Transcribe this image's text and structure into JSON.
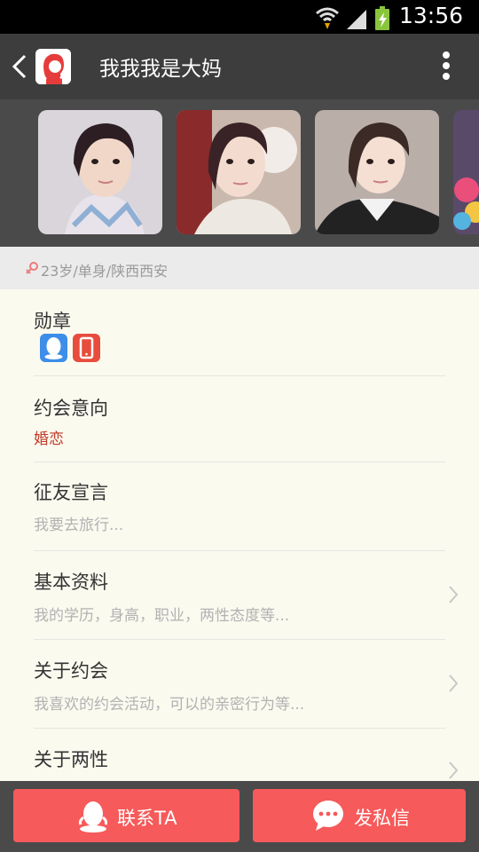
{
  "status_bar": {
    "time": "13:56"
  },
  "header": {
    "title": "我我我是大妈"
  },
  "profile_info": "23岁/单身/陕西西安",
  "sections": {
    "badges": {
      "title": "勋章"
    },
    "dating_intent": {
      "title": "约会意向",
      "value": "婚恋"
    },
    "manifesto": {
      "title": "征友宣言",
      "value": "我要去旅行..."
    },
    "basic_info": {
      "title": "基本资料",
      "value": "我的学历，身高，职业，两性态度等..."
    },
    "about_dating": {
      "title": "关于约会",
      "value": "我喜欢的约会活动，可以的亲密行为等..."
    },
    "about_gender": {
      "title": "关于两性"
    }
  },
  "bottom_bar": {
    "contact_label": "联系TA",
    "message_label": "发私信"
  },
  "colors": {
    "accent": "#f65a5a",
    "header_bg": "#3d3d3d",
    "badge_qq": "#3d8ee8",
    "badge_phone": "#e74c3c",
    "intent_red": "#c0392b"
  },
  "icons": [
    "wifi-icon",
    "signal-icon",
    "battery-icon",
    "back-arrow-icon",
    "more-vertical-icon",
    "female-icon",
    "qq-badge-icon",
    "phone-badge-icon",
    "chevron-right-icon",
    "penguin-icon",
    "chat-bubble-icon"
  ]
}
